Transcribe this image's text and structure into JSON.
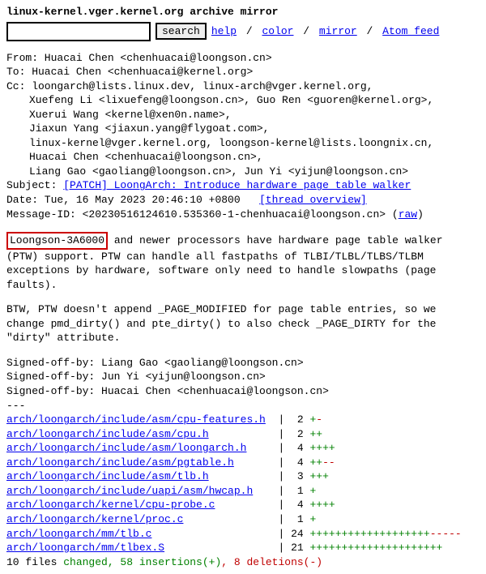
{
  "header": {
    "title": "linux-kernel.vger.kernel.org archive mirror",
    "search_button": "search",
    "links": [
      "help",
      "color",
      "mirror",
      "Atom feed"
    ],
    "sep": "/"
  },
  "msg": {
    "from_label": "From: Huacai Chen <chenhuacai@loongson.cn>",
    "to_label": "To: Huacai Chen <chenhuacai@kernel.org>",
    "cc_label": "Cc: loongarch@lists.linux.dev, linux-arch@vger.kernel.org,",
    "cc_lines": [
      "Xuefeng Li <lixuefeng@loongson.cn>, Guo Ren <guoren@kernel.org>,",
      "Xuerui Wang <kernel@xen0n.name>,",
      "Jiaxun Yang <jiaxun.yang@flygoat.com>,",
      "linux-kernel@vger.kernel.org, loongson-kernel@lists.loongnix.cn,",
      "Huacai Chen <chenhuacai@loongson.cn>,",
      "Liang Gao <gaoliang@loongson.cn>, Jun Yi <yijun@loongson.cn>"
    ],
    "subject_label": "Subject: ",
    "subject_link": "[PATCH] LoongArch: Introduce hardware page table walker",
    "date_label": "Date: Tue, 16 May 2023 20:46:10 +0800   ",
    "thread_link": "[thread overview]",
    "msgid_pre": "Message-ID: <20230516124610.535360-1-chenhuacai@loongson.cn> (",
    "raw_link": "raw",
    "msgid_post": ")"
  },
  "highlight": "Loongson-3A6000",
  "body_after_hl": " and newer processors have hardware page table walker",
  "body_p1_rest": "(PTW) support. PTW can handle all fastpaths of TLBI/TLBL/TLBS/TLBM\nexceptions by hardware, software only need to handle slowpaths (page\nfaults).",
  "body_p2": "BTW, PTW doesn't append _PAGE_MODIFIED for page table entries, so we\nchange pmd_dirty() and pte_dirty() to also check _PAGE_DIRTY for the\n\"dirty\" attribute.",
  "signed": [
    "Signed-off-by: Liang Gao <gaoliang@loongson.cn>",
    "Signed-off-by: Jun Yi <yijun@loongson.cn>",
    "Signed-off-by: Huacai Chen <chenhuacai@loongson.cn>"
  ],
  "dashes": "---",
  "diff": [
    {
      "path": "arch/loongarch/include/asm/cpu-features.h",
      "pad": " ",
      "n": " 2",
      "plus": "+",
      "minus": "-"
    },
    {
      "path": "arch/loongarch/include/asm/cpu.h",
      "pad": "          ",
      "n": " 2",
      "plus": "++",
      "minus": ""
    },
    {
      "path": "arch/loongarch/include/asm/loongarch.h",
      "pad": "    ",
      "n": " 4",
      "plus": "++++",
      "minus": ""
    },
    {
      "path": "arch/loongarch/include/asm/pgtable.h",
      "pad": "      ",
      "n": " 4",
      "plus": "++",
      "minus": "--"
    },
    {
      "path": "arch/loongarch/include/asm/tlb.h",
      "pad": "          ",
      "n": " 3",
      "plus": "+++",
      "minus": ""
    },
    {
      "path": "arch/loongarch/include/uapi/asm/hwcap.h",
      "pad": "   ",
      "n": " 1",
      "plus": "+",
      "minus": ""
    },
    {
      "path": "arch/loongarch/kernel/cpu-probe.c",
      "pad": "         ",
      "n": " 4",
      "plus": "++++",
      "minus": ""
    },
    {
      "path": "arch/loongarch/kernel/proc.c",
      "pad": "              ",
      "n": " 1",
      "plus": "+",
      "minus": ""
    },
    {
      "path": "arch/loongarch/mm/tlb.c",
      "pad": "                   ",
      "n": "24",
      "plus": "+++++++++++++++++++",
      "minus": "-----"
    },
    {
      "path": "arch/loongarch/mm/tlbex.S",
      "pad": "                 ",
      "n": "21",
      "plus": "+++++++++++++++++++++",
      "minus": ""
    }
  ],
  "summary_pre": " 10 files ",
  "summary_changed": "changed",
  "summary_ins": ", 58 insertions(+)",
  "summary_del": ", 8 deletions(-)"
}
